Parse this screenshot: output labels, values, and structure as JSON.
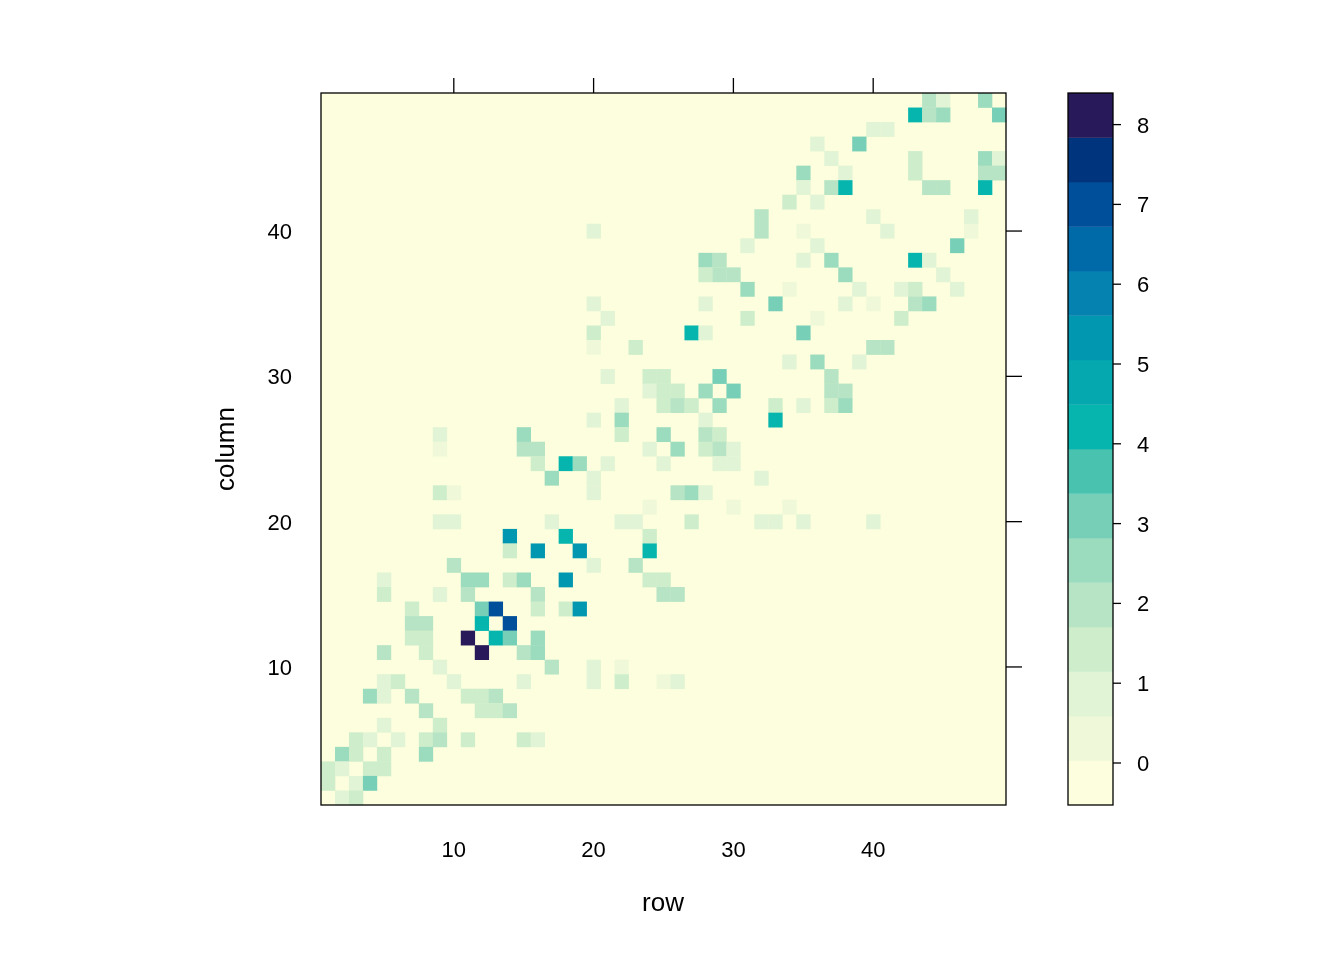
{
  "plot": {
    "xlabel": "row",
    "ylabel": "column",
    "xtick_labels": [
      "10",
      "20",
      "30",
      "40"
    ],
    "ytick_labels": [
      "40",
      "30",
      "20",
      "10"
    ],
    "colorbar_labels": [
      "8",
      "7",
      "6",
      "5",
      "4",
      "3",
      "2",
      "1",
      "0"
    ]
  }
}
